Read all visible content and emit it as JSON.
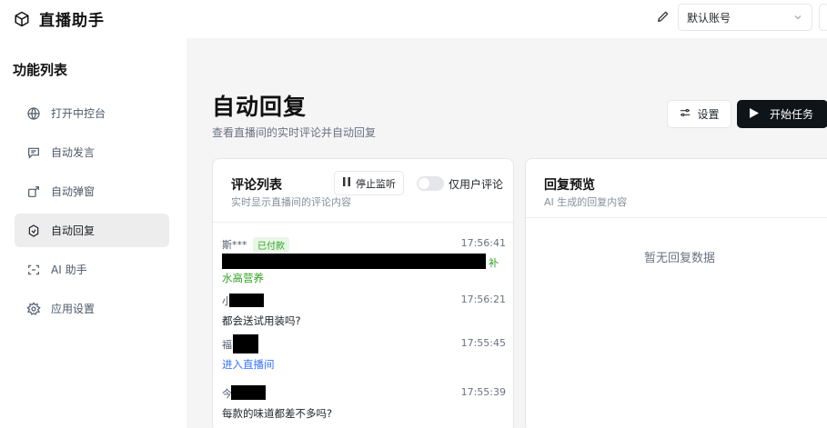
{
  "app": {
    "title": "直播助手",
    "account": "默认账号"
  },
  "sidebar": {
    "heading": "功能列表",
    "items": [
      {
        "label": "打开中控台",
        "icon": "globe-icon"
      },
      {
        "label": "自动发言",
        "icon": "message-square-icon"
      },
      {
        "label": "自动弹窗",
        "icon": "popup-icon"
      },
      {
        "label": "自动回复",
        "icon": "reply-icon",
        "active": true
      },
      {
        "label": "AI 助手",
        "icon": "bot-icon"
      },
      {
        "label": "应用设置",
        "icon": "gear-icon"
      }
    ]
  },
  "page": {
    "title": "自动回复",
    "subtitle": "查看直播间的实时评论并自动回复",
    "settings_label": "设置",
    "start_label": "开始任务"
  },
  "comments_card": {
    "title": "评论列表",
    "subtitle": "实时显示直播间的评论内容",
    "stop_label": "停止监听",
    "toggle_label": "仅用户评论",
    "items": [
      {
        "user": "斯***",
        "badge": "已付款",
        "time": "17:56:41",
        "text": "水高营养",
        "tail": "补",
        "style": "green"
      },
      {
        "user": "小",
        "time": "17:56:21",
        "text": "都会送试用装吗?",
        "style": "normal"
      },
      {
        "user": "福",
        "time": "17:55:45",
        "text": "进入直播间",
        "style": "link"
      },
      {
        "user": "今",
        "time": "17:55:39",
        "text": "每款的味道都差不多吗?",
        "style": "normal"
      }
    ]
  },
  "preview_card": {
    "title": "回复预览",
    "subtitle": "AI 生成的回复内容",
    "empty": "暂无回复数据"
  }
}
